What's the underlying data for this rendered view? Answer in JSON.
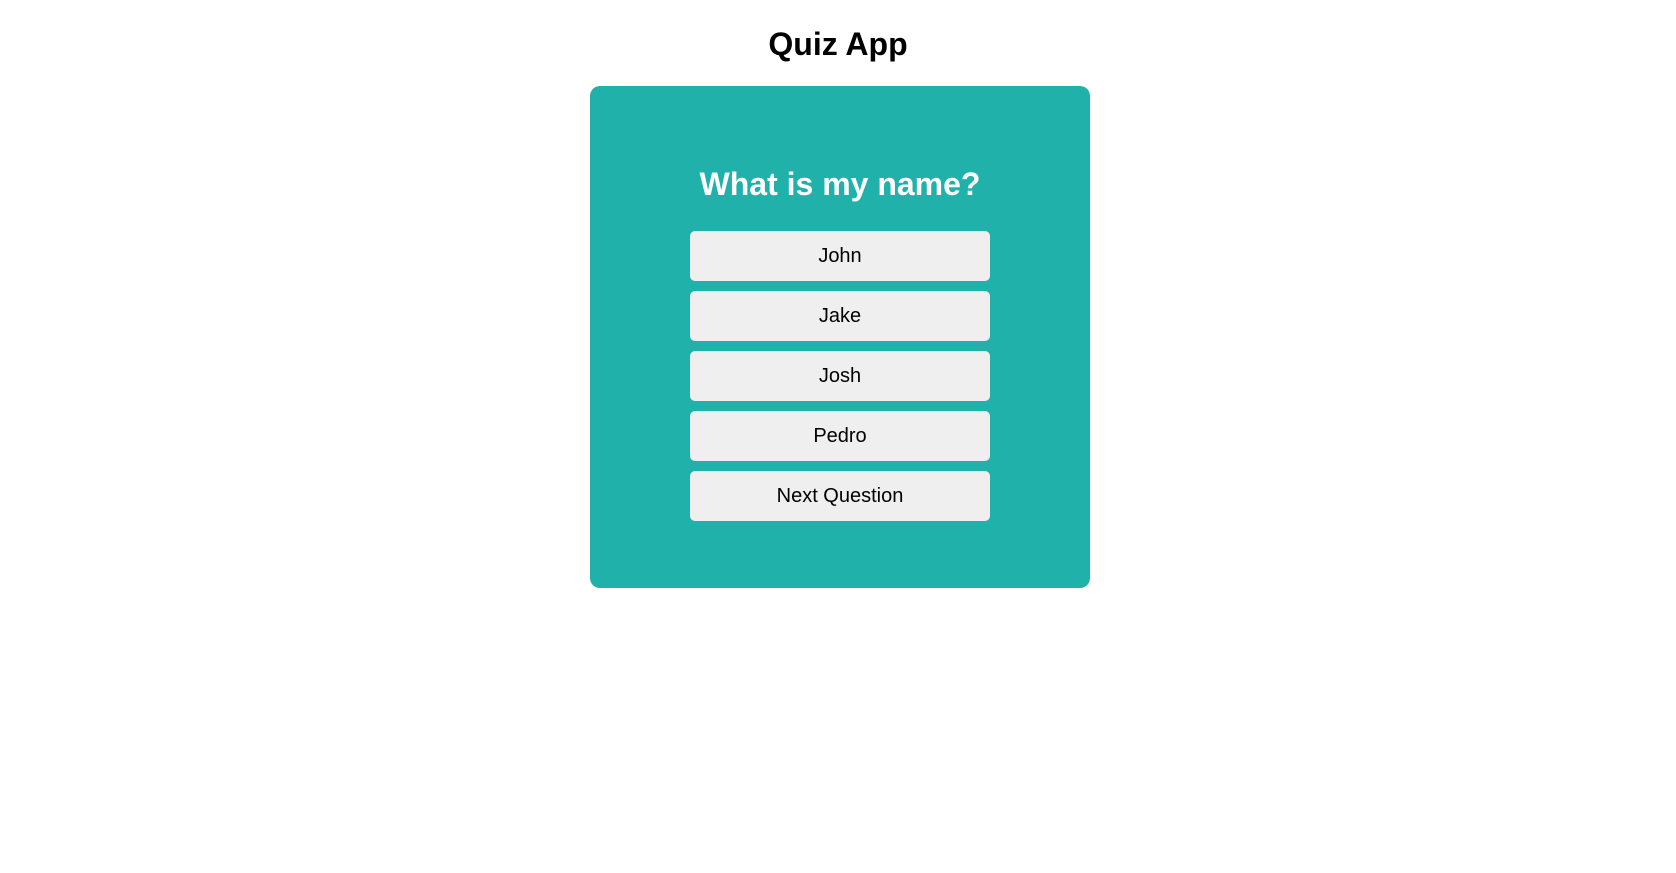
{
  "header": {
    "title": "Quiz App"
  },
  "quiz": {
    "question": "What is my name?",
    "answers": [
      "John",
      "Jake",
      "Josh",
      "Pedro"
    ],
    "next_label": "Next Question"
  },
  "colors": {
    "card": "#20b2aa",
    "button": "#efefef"
  }
}
